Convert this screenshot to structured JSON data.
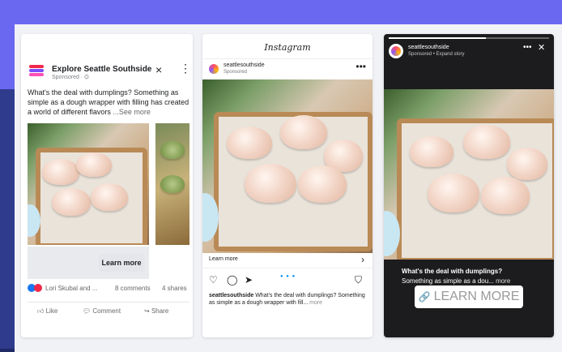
{
  "colors": {
    "accent": "#6a67f0",
    "dark_bg": "#2f3b8c",
    "fb_blue": "#1877f2",
    "fb_red": "#f02849"
  },
  "facebook": {
    "page_name": "Explore Seattle Southside",
    "sponsored": "Sponsored · ⛭",
    "close_icon": "×",
    "more_icon": "⋮",
    "post_text": "What's the deal with dumplings? Something as simple as a dough wrapper with filling has created a world of different flavors",
    "see_more": "...See more",
    "learn_more": "Learn more",
    "reactions_text": "Lori Skubal and ...",
    "comments": "8 comments",
    "shares": "4 shares",
    "actions": {
      "like": "Like",
      "comment": "Comment",
      "share": "Share"
    }
  },
  "instagram": {
    "brand": "Instagram",
    "username": "seattlesouthside",
    "sponsored": "Sponsored",
    "more_icon": "•••",
    "learn_more": "Learn more",
    "chevron": "›",
    "pagination": "● ● ●",
    "caption_user": "seattlesouthside",
    "caption": " What's the deal with dumplings? Something as simple as a dough wrapper with fill...",
    "caption_more": "more"
  },
  "story": {
    "username": "seattlesouthside",
    "sponsored": "Sponsored • Expand story",
    "more_icon": "•••",
    "close_icon": "✕",
    "caption_line1": "What's the deal with dumplings?",
    "caption_line2": "Something as simple as a dou...",
    "caption_more": " more",
    "learn_more": "LEARN MORE",
    "link_icon": "🔗"
  }
}
